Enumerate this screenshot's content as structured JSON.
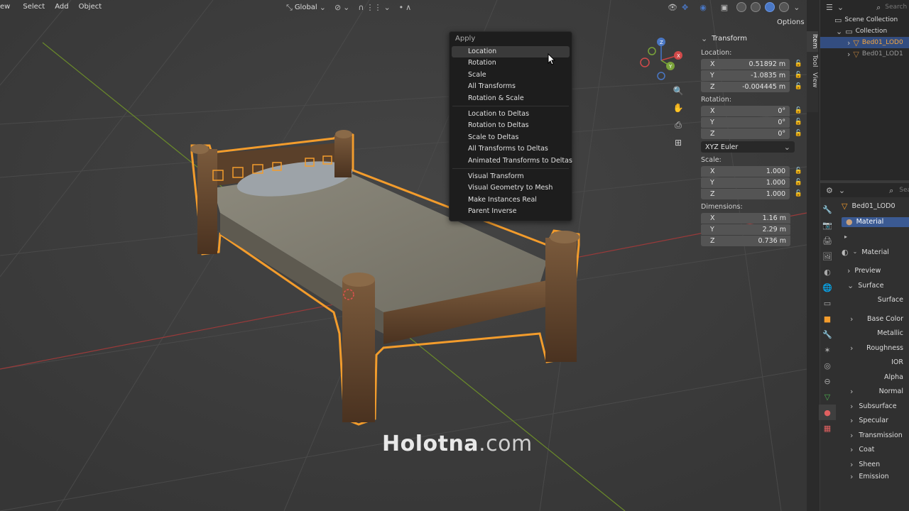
{
  "menubar": {
    "items": [
      "ew",
      "Select",
      "Add",
      "Object"
    ]
  },
  "header": {
    "transform_orientation": "Global",
    "options_label": "Options"
  },
  "apply_menu": {
    "title": "Apply",
    "groups": [
      [
        "Location",
        "Rotation",
        "Scale",
        "All Transforms",
        "Rotation & Scale"
      ],
      [
        "Location to Deltas",
        "Rotation to Deltas",
        "Scale to Deltas",
        "All Transforms to Deltas",
        "Animated Transforms to Deltas"
      ],
      [
        "Visual Transform",
        "Visual Geometry to Mesh",
        "Make Instances Real",
        "Parent Inverse"
      ]
    ],
    "hovered": "Location"
  },
  "transform_panel": {
    "title": "Transform",
    "location_label": "Location:",
    "location": [
      {
        "axis": "X",
        "value": "0.51892 m"
      },
      {
        "axis": "Y",
        "value": "-1.0835 m"
      },
      {
        "axis": "Z",
        "value": "-0.004445 m"
      }
    ],
    "rotation_label": "Rotation:",
    "rotation": [
      {
        "axis": "X",
        "value": "0°"
      },
      {
        "axis": "Y",
        "value": "0°"
      },
      {
        "axis": "Z",
        "value": "0°"
      }
    ],
    "rotation_mode": "XYZ Euler",
    "scale_label": "Scale:",
    "scale": [
      {
        "axis": "X",
        "value": "1.000"
      },
      {
        "axis": "Y",
        "value": "1.000"
      },
      {
        "axis": "Z",
        "value": "1.000"
      }
    ],
    "dimensions_label": "Dimensions:",
    "dimensions": [
      {
        "axis": "X",
        "value": "1.16 m"
      },
      {
        "axis": "Y",
        "value": "2.29 m"
      },
      {
        "axis": "Z",
        "value": "0.736 m"
      }
    ]
  },
  "side_tabs": [
    "Item",
    "Tool",
    "View"
  ],
  "outliner": {
    "search_placeholder": "Search",
    "rows": [
      {
        "label": "Scene Collection",
        "indent": 0
      },
      {
        "label": "Collection",
        "indent": 1
      },
      {
        "label": "Bed01_LOD0",
        "indent": 2,
        "selected": true
      },
      {
        "label": "Bed01_LOD1",
        "indent": 2,
        "dim": true
      }
    ]
  },
  "properties": {
    "search_placeholder": "Search",
    "object_name": "Bed01_LOD0",
    "material_slot": "Material",
    "material_name": "Material",
    "rows": [
      "Preview",
      "Surface",
      "Surface",
      "Base Color",
      "Metallic",
      "Roughness",
      "IOR",
      "Alpha",
      "Normal",
      "Subsurface",
      "Specular",
      "Transmission",
      "Coat",
      "Sheen",
      "Emission"
    ]
  },
  "watermark": {
    "brand": "Holotna",
    "suffix": ".com"
  },
  "colors": {
    "selection_outline": "#f39c2c",
    "accent_blue": "#4a77c4",
    "x_axis": "#c44a4a",
    "y_axis": "#7aa33a"
  }
}
